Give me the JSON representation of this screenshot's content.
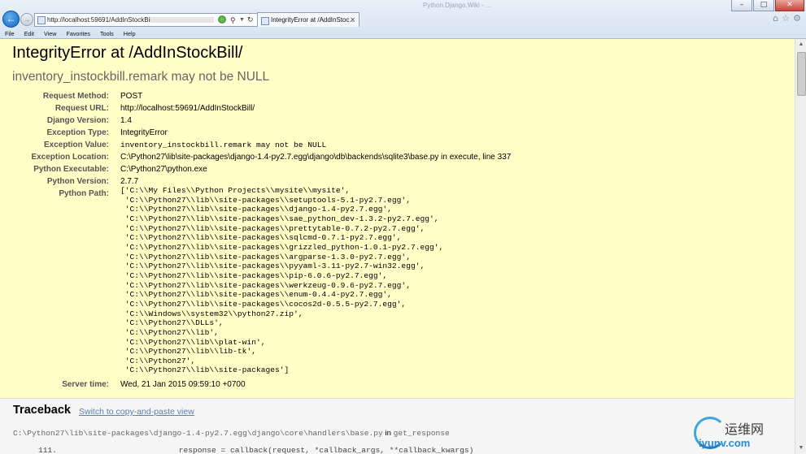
{
  "browser": {
    "window_title": "Python.Django.Wiki - ...",
    "url": "http://localhost:59691/AddInStockBill/",
    "tab_title": "IntegrityError at /AddInStoc...",
    "menu": [
      "File",
      "Edit",
      "View",
      "Favorites",
      "Tools",
      "Help"
    ],
    "window_controls": {
      "minimize": "–",
      "maximize": "□",
      "close": "✕"
    }
  },
  "error": {
    "title": "IntegrityError at /AddInStockBill/",
    "subtitle": "inventory_instockbill.remark may not be NULL"
  },
  "meta": [
    {
      "key": "Request Method:",
      "value": "POST",
      "mono": false
    },
    {
      "key": "Request URL:",
      "value": "http://localhost:59691/AddInStockBill/",
      "mono": false
    },
    {
      "key": "Django Version:",
      "value": "1.4",
      "mono": false
    },
    {
      "key": "Exception Type:",
      "value": "IntegrityError",
      "mono": false
    },
    {
      "key": "Exception Value:",
      "value": "inventory_instockbill.remark may not be NULL",
      "mono": true
    },
    {
      "key": "Exception Location:",
      "value": "C:\\Python27\\lib\\site-packages\\django-1.4-py2.7.egg\\django\\db\\backends\\sqlite3\\base.py in execute, line 337",
      "mono": false
    },
    {
      "key": "Python Executable:",
      "value": "C:\\Python27\\python.exe",
      "mono": false
    },
    {
      "key": "Python Version:",
      "value": "2.7.7",
      "mono": false
    }
  ],
  "python_path": {
    "key": "Python Path:",
    "lines": [
      "['C:\\\\My Files\\\\Python Projects\\\\mysite\\\\mysite',",
      " 'C:\\\\Python27\\\\lib\\\\site-packages\\\\setuptools-5.1-py2.7.egg',",
      " 'C:\\\\Python27\\\\lib\\\\site-packages\\\\django-1.4-py2.7.egg',",
      " 'C:\\\\Python27\\\\lib\\\\site-packages\\\\sae_python_dev-1.3.2-py2.7.egg',",
      " 'C:\\\\Python27\\\\lib\\\\site-packages\\\\prettytable-0.7.2-py2.7.egg',",
      " 'C:\\\\Python27\\\\lib\\\\site-packages\\\\sqlcmd-0.7.1-py2.7.egg',",
      " 'C:\\\\Python27\\\\lib\\\\site-packages\\\\grizzled_python-1.0.1-py2.7.egg',",
      " 'C:\\\\Python27\\\\lib\\\\site-packages\\\\argparse-1.3.0-py2.7.egg',",
      " 'C:\\\\Python27\\\\lib\\\\site-packages\\\\pyyaml-3.11-py2.7-win32.egg',",
      " 'C:\\\\Python27\\\\lib\\\\site-packages\\\\pip-6.0.6-py2.7.egg',",
      " 'C:\\\\Python27\\\\lib\\\\site-packages\\\\werkzeug-0.9.6-py2.7.egg',",
      " 'C:\\\\Python27\\\\lib\\\\site-packages\\\\enum-0.4.4-py2.7.egg',",
      " 'C:\\\\Python27\\\\lib\\\\site-packages\\\\cocos2d-0.5.5-py2.7.egg',",
      " 'C:\\\\Windows\\\\system32\\\\python27.zip',",
      " 'C:\\\\Python27\\\\DLLs',",
      " 'C:\\\\Python27\\\\lib',",
      " 'C:\\\\Python27\\\\lib\\\\plat-win',",
      " 'C:\\\\Python27\\\\lib\\\\lib-tk',",
      " 'C:\\\\Python27',",
      " 'C:\\\\Python27\\\\lib\\\\site-packages']"
    ]
  },
  "server_time": {
    "key": "Server time:",
    "value": "Wed, 21 Jan 2015 09:59:10 +0700"
  },
  "traceback": {
    "heading": "Traceback",
    "switch_link": "Switch to copy-and-paste view",
    "file": "C:\\Python27\\lib\\site-packages\\django-1.4-py2.7.egg\\django\\core\\handlers\\base.py",
    "in_word": " in ",
    "function": "get_response",
    "code_line": "111.                          response = callback(request, *callback_args, **callback_kwargs)"
  },
  "watermark": {
    "cn": "运维网",
    "en": "iyunv.com"
  },
  "colors": {
    "summary_bg": "#ffffc8",
    "traceback_bg": "#f5f5f5",
    "link": "#5b80b2",
    "label": "#555555"
  }
}
